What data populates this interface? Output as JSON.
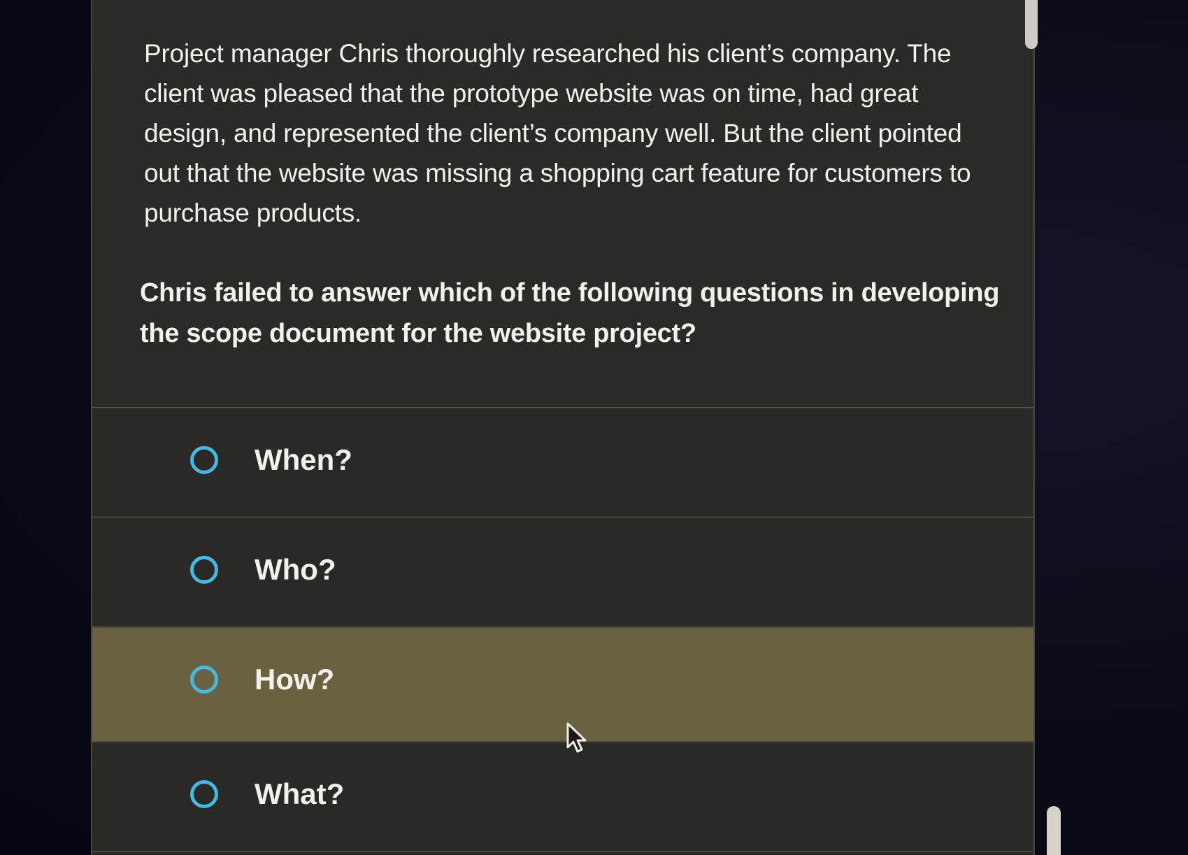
{
  "question": {
    "passage": "Project manager Chris thoroughly researched his client’s company. The client was pleased that the prototype website was on time, had great design, and represented the client’s company well.  But the client pointed out that the website was missing a shopping cart feature for customers to purchase products.",
    "prompt": "Chris failed to answer which of the following questions in developing the scope document for the website project?"
  },
  "options": [
    {
      "label": "When?",
      "selected": false
    },
    {
      "label": "Who?",
      "selected": false
    },
    {
      "label": "How?",
      "selected": false,
      "hovered": true
    },
    {
      "label": "What?",
      "selected": false
    }
  ],
  "colors": {
    "panel": "#2d2b27",
    "hover": "#6a6140",
    "radio": "#45b8e4",
    "text": "#f4f1ec"
  },
  "icons": {
    "cursor": "mouse-pointer-icon"
  }
}
